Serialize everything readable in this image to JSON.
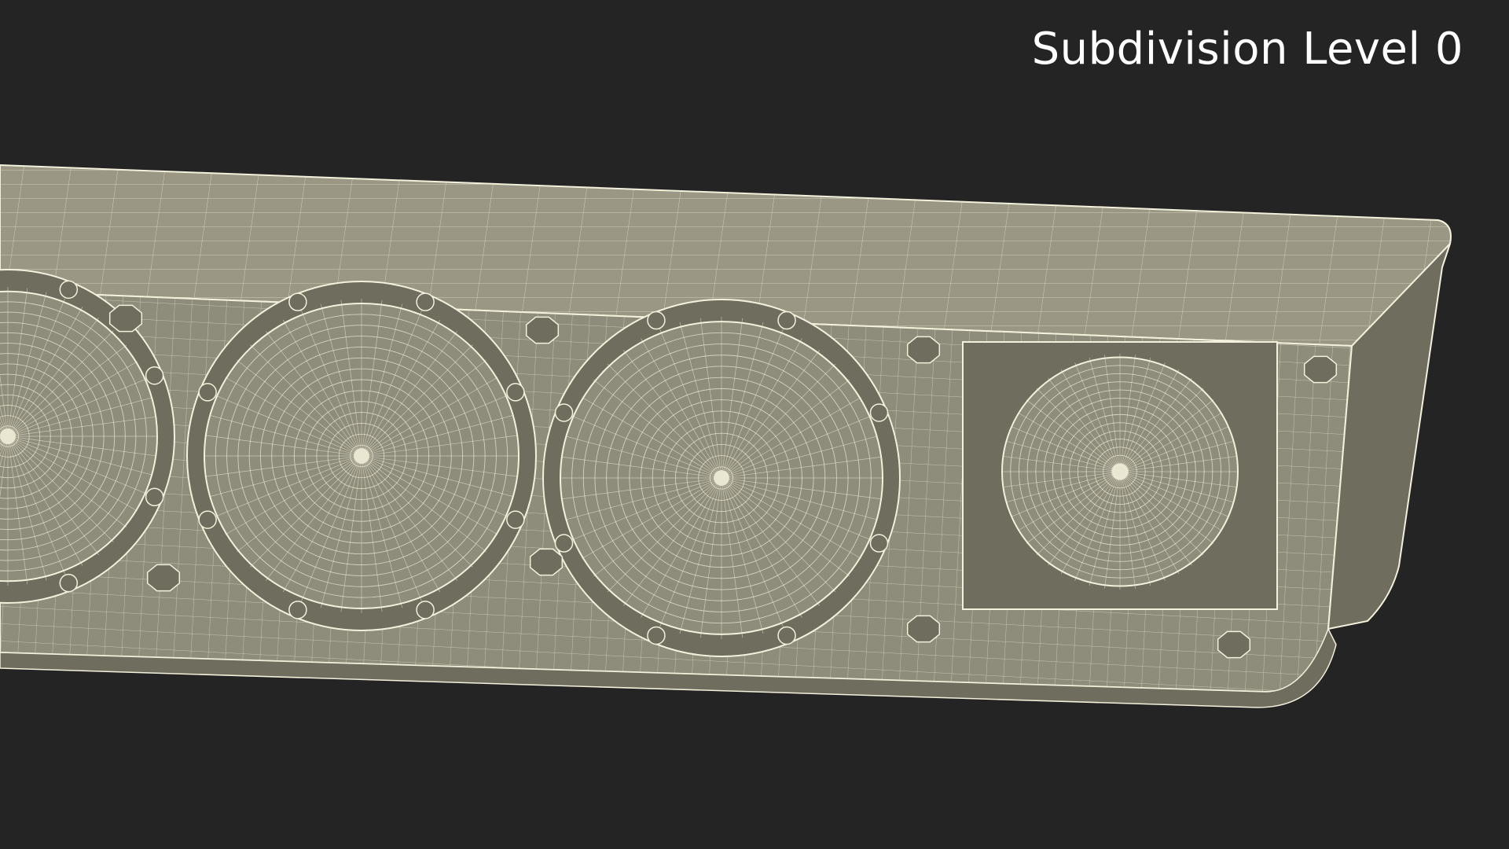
{
  "overlay": {
    "label": "Subdivision Level 0"
  },
  "render": {
    "subject": "soundbar-wireframe",
    "colors": {
      "background": "#242424",
      "surface": "#8e8c7a",
      "surface_dark": "#6f6d5e",
      "surface_top": "#9a9884",
      "wire": "#f3f0dc"
    },
    "drivers": [
      {
        "name": "woofer-left",
        "kind": "woofer"
      },
      {
        "name": "woofer-center-left",
        "kind": "woofer"
      },
      {
        "name": "woofer-center-right",
        "kind": "woofer"
      },
      {
        "name": "tweeter-right",
        "kind": "tweeter"
      }
    ]
  }
}
